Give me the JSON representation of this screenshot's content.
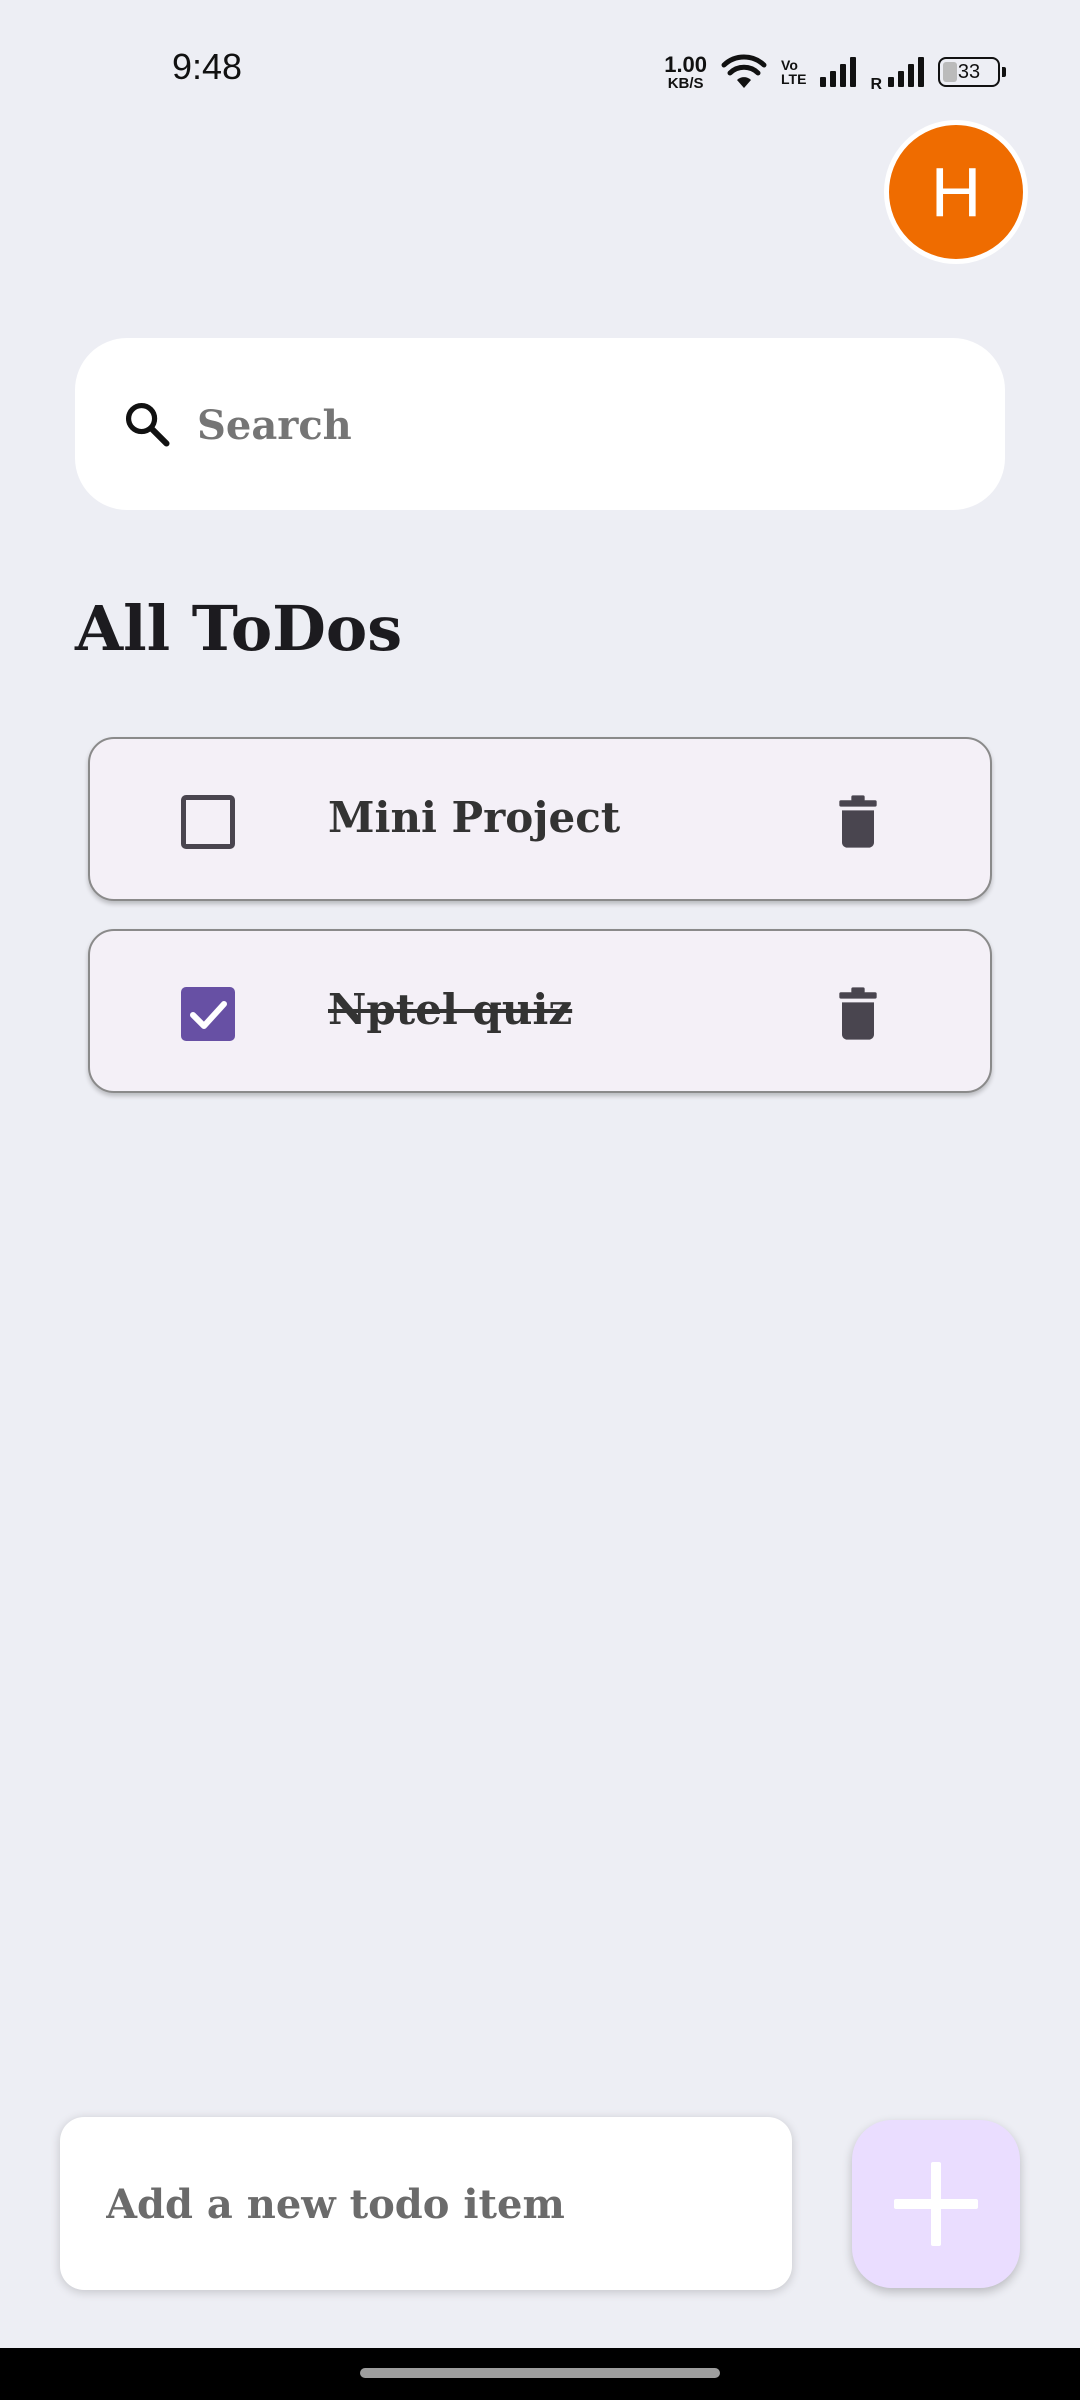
{
  "status_bar": {
    "time": "9:48",
    "net_speed_value": "1.00",
    "net_speed_unit": "KB/S",
    "volte_top": "Vo",
    "volte_bottom": "LTE",
    "roaming": "R",
    "battery": "33"
  },
  "avatar": {
    "initial": "H",
    "color": "#EF6C00"
  },
  "search": {
    "placeholder": "Search",
    "icon": "search-icon"
  },
  "heading": "All ToDos",
  "todos": [
    {
      "text": "Mini Project",
      "checked": false
    },
    {
      "text": "Nptel quiz",
      "checked": true
    }
  ],
  "add_todo": {
    "placeholder": "Add a new todo item",
    "fab_icon": "plus-icon"
  },
  "colors": {
    "background": "#EDEEF4",
    "accent": "#6750A4",
    "fab": "#EADDFF",
    "card": "#F4F0F7"
  }
}
